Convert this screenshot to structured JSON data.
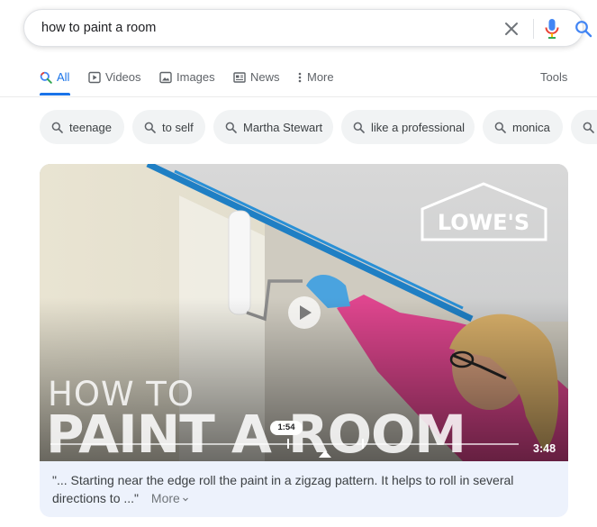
{
  "search": {
    "query": "how to paint a room"
  },
  "tabs": [
    {
      "label": "All",
      "icon": "search-icon",
      "active": true
    },
    {
      "label": "Videos",
      "icon": "video-icon"
    },
    {
      "label": "Images",
      "icon": "image-icon"
    },
    {
      "label": "News",
      "icon": "news-icon"
    },
    {
      "label": "More",
      "icon": "vertical-dots-icon"
    }
  ],
  "tools_label": "Tools",
  "chips": [
    {
      "label": "teenage"
    },
    {
      "label": "to self"
    },
    {
      "label": "Martha Stewart"
    },
    {
      "label": "like a professional"
    },
    {
      "label": "monica"
    }
  ],
  "video": {
    "brand_logo_text": "LOWE'S",
    "title_line1": "HOW TO",
    "title_line2": "PAINT A ROOM",
    "current_time": "1:54",
    "duration": "3:48",
    "snippet": "\"... Starting near the edge roll the paint in a zigzag pattern. It helps to roll in several directions to ...\"",
    "more_label": "More"
  },
  "colors": {
    "accent_blue": "#1a73e8",
    "google_blue": "#4285f4",
    "google_red": "#ea4335",
    "chip_bg": "#f1f3f4",
    "card_bg": "#edf2fc",
    "painters_tape": "#1f7fc4",
    "sleeve_pink": "#e0468f",
    "glove_blue": "#4aa3df"
  }
}
